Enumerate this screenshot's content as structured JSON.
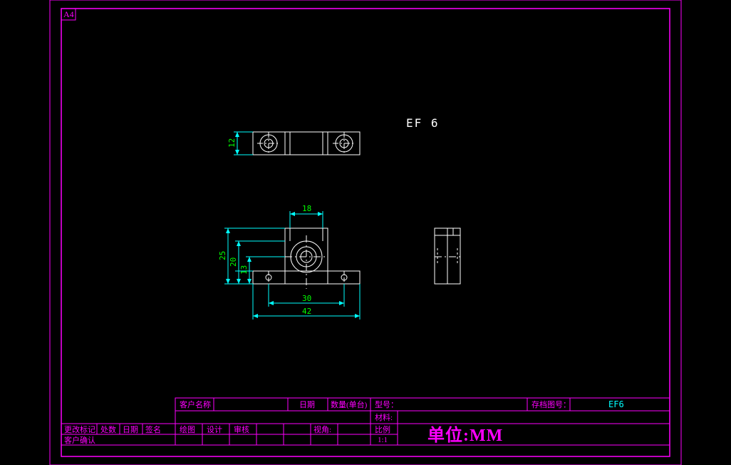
{
  "sheet": {
    "size_label": "A4",
    "part_label": "EF 6",
    "unit_label": "单位:MM"
  },
  "dimensions": {
    "top_view_height": "12",
    "front_width_top": "18",
    "front_height_outer": "25",
    "front_height_mid": "20",
    "front_height_inner": "13",
    "front_width_mid": "30",
    "front_width_bottom": "42"
  },
  "title_block": {
    "row1": {
      "customer_name": "客户名称",
      "date": "日期",
      "qty": "数量(单台)",
      "model": "型号：",
      "archive_no": "存档图号：",
      "archive_val": "EF6"
    },
    "row2": {
      "material": "材料:"
    },
    "row3": {
      "drawn": "绘图",
      "design": "设计",
      "check": "审核",
      "view": "视角:",
      "scale": "比例"
    },
    "row4": {
      "scale_val": "1:1"
    },
    "left_block": {
      "change_mark": "更改标记",
      "count": "处数",
      "date": "日期",
      "sign": "签名",
      "customer_confirm": "客户确认"
    }
  }
}
